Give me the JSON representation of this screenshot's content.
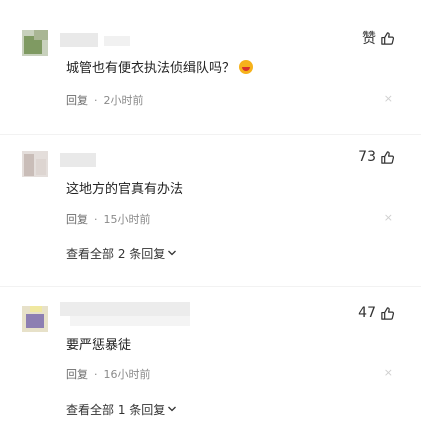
{
  "comments": [
    {
      "like_label": "赞",
      "text": "城管也有便衣执法侦缉队吗？",
      "emoji": "laughing-face",
      "reply_label": "回复",
      "dot": "·",
      "time": "2小时前",
      "close": "×"
    },
    {
      "like_count": "73",
      "text": "这地方的官真有办法",
      "reply_label": "回复",
      "dot": "·",
      "time": "15小时前",
      "close": "×",
      "view_replies": "查看全部 2 条回复"
    },
    {
      "like_count": "47",
      "text": "要严惩暴徒",
      "reply_label": "回复",
      "dot": "·",
      "time": "16小时前",
      "close": "×",
      "view_replies": "查看全部 1 条回复"
    }
  ],
  "colors": {
    "avatar1": [
      "#7f9a62",
      "#c8d1bd"
    ],
    "avatar2": [
      "#c9bdb8",
      "#e4dedb"
    ],
    "avatar3": [
      "#8d7fb2",
      "#e7e1c9"
    ]
  }
}
